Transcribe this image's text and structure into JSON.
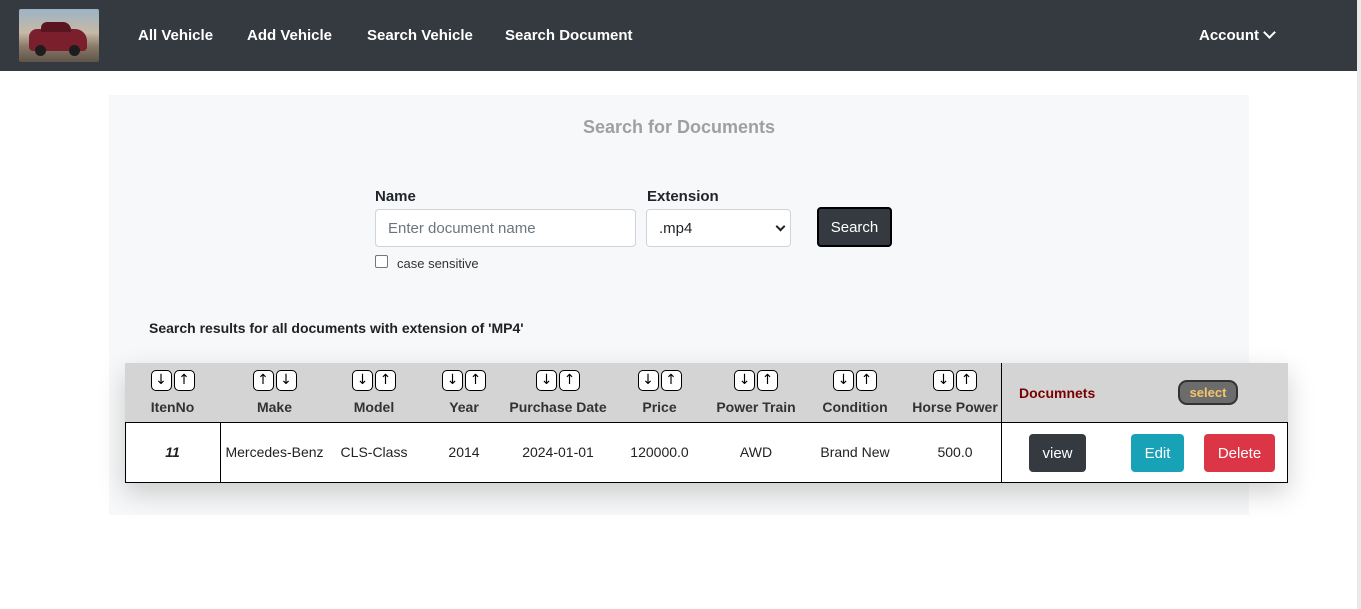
{
  "nav": {
    "logo_alt": "car logo",
    "links": [
      "All Vehicle",
      "Add Vehicle",
      "Search Vehicle",
      "Search Document"
    ],
    "account_label": "Account"
  },
  "search": {
    "title": "Search for Documents",
    "name_label": "Name",
    "name_placeholder": "Enter document name",
    "name_value": "",
    "extension_label": "Extension",
    "extension_selected": ".mp4",
    "search_button": "Search",
    "case_sensitive_label": "case sensitive",
    "case_sensitive_checked": false
  },
  "results": {
    "heading": "Search results for all documents with extension of 'MP4'",
    "columns": [
      {
        "label": "ItenNo",
        "sort1": "↓",
        "sort2": "↑"
      },
      {
        "label": "Make",
        "sort1": "↑",
        "sort2": "↓"
      },
      {
        "label": "Model",
        "sort1": "↓",
        "sort2": "↑"
      },
      {
        "label": "Year",
        "sort1": "↓",
        "sort2": "↑"
      },
      {
        "label": "Purchase Date",
        "sort1": "↓",
        "sort2": "↑"
      },
      {
        "label": "Price",
        "sort1": "↓",
        "sort2": "↑"
      },
      {
        "label": "Power Train",
        "sort1": "↓",
        "sort2": "↑"
      },
      {
        "label": "Condition",
        "sort1": "↓",
        "sort2": "↑"
      },
      {
        "label": "Horse Power",
        "sort1": "↓",
        "sort2": "↑"
      }
    ],
    "documents_label": "Documnets",
    "select_label": "select",
    "rows": [
      {
        "itemNo": "11",
        "make": "Mercedes-Benz",
        "model": "CLS-Class",
        "year": "2014",
        "purchase_date": "2024-01-01",
        "price": "120000.0",
        "power_train": "AWD",
        "condition": "Brand New",
        "horse_power": "500.0",
        "view_label": "view",
        "edit_label": "Edit",
        "delete_label": "Delete"
      }
    ]
  },
  "colors": {
    "navbar": "#343a40",
    "panel": "#f7f8f9",
    "table_header": "#d4d4d4",
    "documents_label": "#7a0000",
    "edit": "#17a2b8",
    "delete": "#dc3545"
  }
}
